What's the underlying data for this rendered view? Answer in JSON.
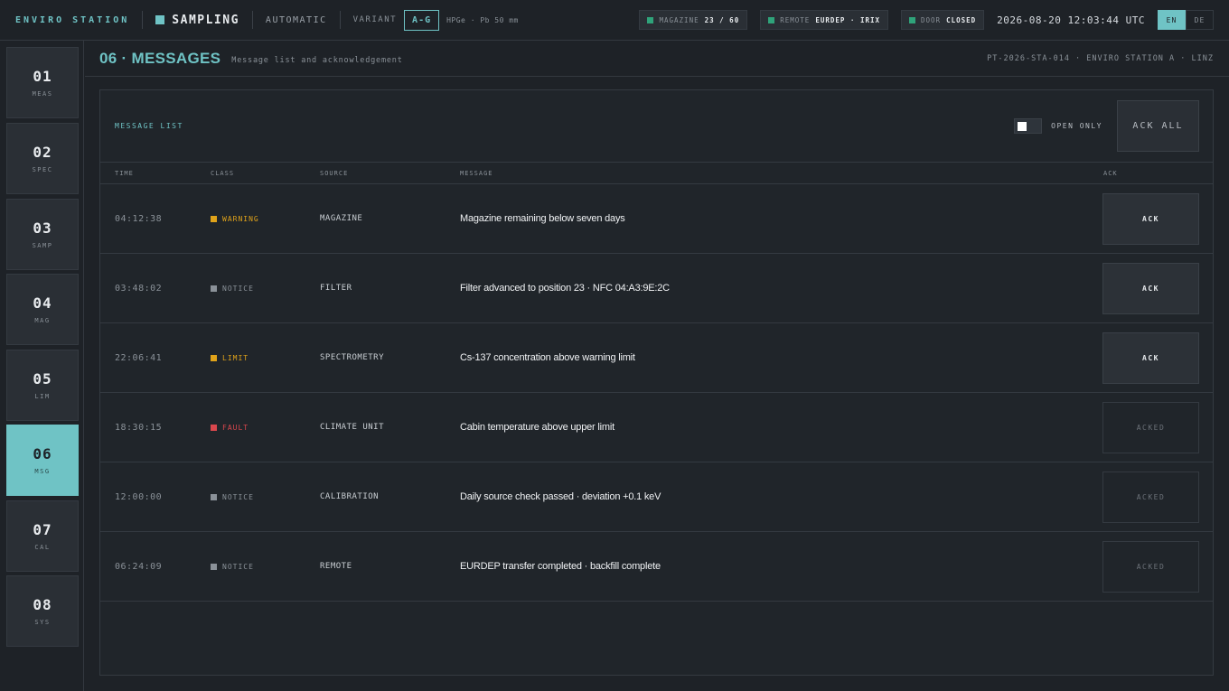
{
  "topbar": {
    "brand": "ENVIRO STATION",
    "mode": "SAMPLING",
    "auto": "AUTOMATIC",
    "variant_label": "VARIANT",
    "variant_value": "A-G",
    "detector": "HPGe · Pb 50 mm",
    "magazine_label": "MAGAZINE",
    "magazine_value": "23 / 60",
    "remote_label": "REMOTE",
    "remote_value": "EURDEP · IRIX",
    "door_label": "DOOR",
    "door_value": "CLOSED",
    "clock": "2026-08-20 12:03:44 UTC",
    "lang_en": "EN",
    "lang_de": "DE",
    "status_color": "#2fa37a",
    "accent_color": "#6fc3c5"
  },
  "sidebar": {
    "items": [
      {
        "num": "01",
        "label": "MEAS"
      },
      {
        "num": "02",
        "label": "SPEC"
      },
      {
        "num": "03",
        "label": "SAMP"
      },
      {
        "num": "04",
        "label": "MAG"
      },
      {
        "num": "05",
        "label": "LIM"
      },
      {
        "num": "06",
        "label": "MSG"
      },
      {
        "num": "07",
        "label": "CAL"
      },
      {
        "num": "08",
        "label": "SYS"
      }
    ],
    "active": "06"
  },
  "page": {
    "title": "06 · MESSAGES",
    "subtitle": "Message list and acknowledgement",
    "location": "PT-2026-STA-014 · ENVIRO STATION A · LINZ"
  },
  "panel": {
    "title": "MESSAGE LIST",
    "toggle_label": "OPEN ONLY",
    "ack_all": "ACK ALL",
    "columns": {
      "time": "TIME",
      "class": "CLASS",
      "source": "SOURCE",
      "message": "MESSAGE",
      "ack": "ACK"
    },
    "rows": [
      {
        "time": "04:12:38",
        "class": "WARNING",
        "class_color": "#e0a31a",
        "source": "MAGAZINE",
        "message": "Magazine remaining below seven days",
        "ack": "ACK",
        "acked": false
      },
      {
        "time": "03:48:02",
        "class": "NOTICE",
        "class_color": "#8a9198",
        "source": "FILTER",
        "message": "Filter advanced to position 23 · NFC 04:A3:9E:2C",
        "ack": "ACK",
        "acked": false
      },
      {
        "time": "22:06:41",
        "class": "LIMIT",
        "class_color": "#e0a31a",
        "source": "SPECTROMETRY",
        "message": "Cs-137 concentration above warning limit",
        "ack": "ACK",
        "acked": false
      },
      {
        "time": "18:30:15",
        "class": "FAULT",
        "class_color": "#d9474d",
        "source": "CLIMATE UNIT",
        "message": "Cabin temperature above upper limit",
        "ack": "ACKED",
        "acked": true
      },
      {
        "time": "12:00:00",
        "class": "NOTICE",
        "class_color": "#8a9198",
        "source": "CALIBRATION",
        "message": "Daily source check passed · deviation +0.1 keV",
        "ack": "ACKED",
        "acked": true
      },
      {
        "time": "06:24:09",
        "class": "NOTICE",
        "class_color": "#8a9198",
        "source": "REMOTE",
        "message": "EURDEP transfer completed · backfill complete",
        "ack": "ACKED",
        "acked": true
      }
    ]
  }
}
